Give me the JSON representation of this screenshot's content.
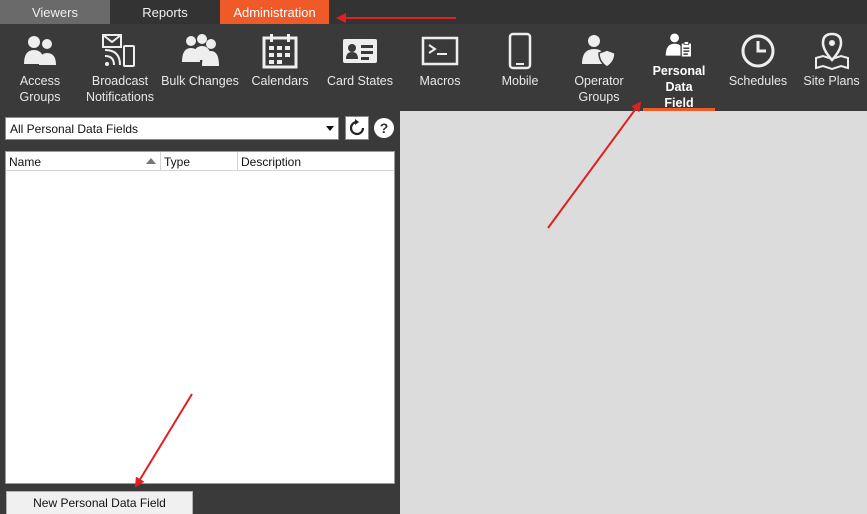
{
  "tabs": [
    {
      "label": "Viewers"
    },
    {
      "label": "Reports"
    },
    {
      "label": "Administration"
    }
  ],
  "ribbon": {
    "items": [
      {
        "label": "Access Groups",
        "icon": "people-group-icon"
      },
      {
        "label": "Broadcast\nNotifications",
        "icon": "broadcast-icon"
      },
      {
        "label": "Bulk Changes",
        "icon": "bulk-people-icon"
      },
      {
        "label": "Calendars",
        "icon": "calendar-icon"
      },
      {
        "label": "Card States",
        "icon": "id-card-icon"
      },
      {
        "label": "Macros",
        "icon": "terminal-icon"
      },
      {
        "label": "Mobile",
        "icon": "mobile-phone-icon"
      },
      {
        "label": "Operator\nGroups",
        "icon": "operator-shield-icon"
      },
      {
        "label": "Personal Data\nField",
        "icon": "person-clipboard-icon"
      },
      {
        "label": "Schedules",
        "icon": "clock-icon"
      },
      {
        "label": "Site Plans",
        "icon": "map-pin-icon"
      }
    ],
    "active": "Personal Data Field"
  },
  "filter": {
    "selected": "All Personal Data Fields"
  },
  "help": {
    "label": "?"
  },
  "grid": {
    "columns": [
      {
        "label": "Name"
      },
      {
        "label": "Type"
      },
      {
        "label": "Description"
      }
    ],
    "rows": []
  },
  "actions": {
    "new_field_label": "New Personal Data Field"
  },
  "colors": {
    "accent": "#f05a28",
    "ribbon_bg": "#3a3a3a",
    "annotation_arrow": "#e02020"
  }
}
